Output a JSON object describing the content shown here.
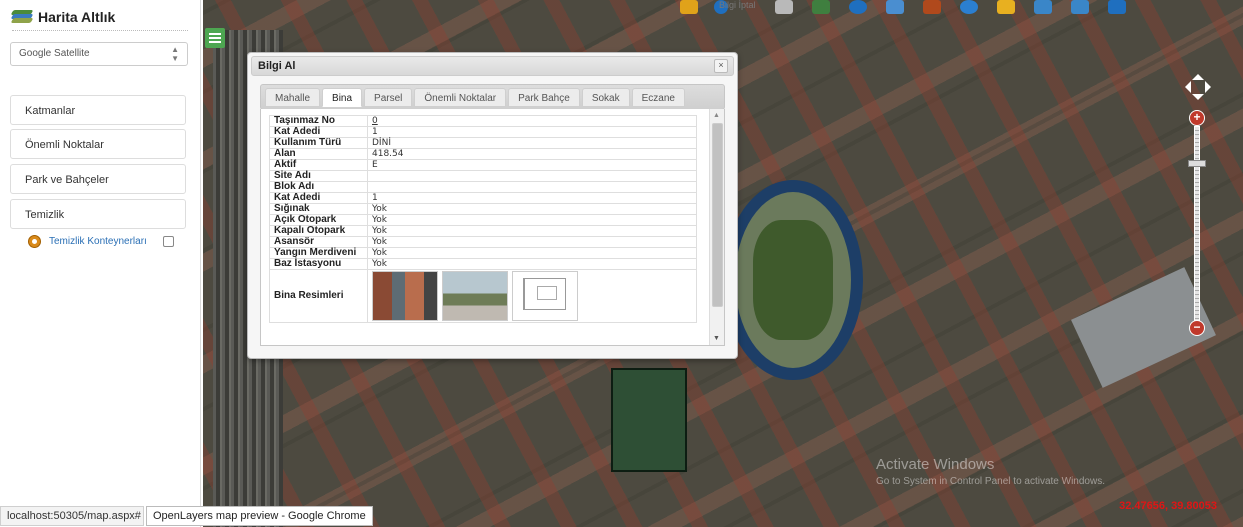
{
  "app": {
    "title": "Harita Altlık"
  },
  "sidebar": {
    "base_layer": {
      "selected": "Google Satellite"
    },
    "menu": [
      {
        "label": "Katmanlar"
      },
      {
        "label": "Önemli Noktalar"
      },
      {
        "label": "Park ve Bahçeler"
      },
      {
        "label": "Temizlik"
      }
    ],
    "temizlik_sub": {
      "label": "Temizlik Konteynerları",
      "checked": false
    }
  },
  "toolbar": {
    "items": [
      {
        "icon": "ruler-pencil-icon",
        "color": "#e0a21a"
      },
      {
        "icon": "info-icon",
        "label": "Bilgi İptal",
        "color": "#1f6fbf"
      },
      {
        "icon": "grid-icon",
        "color": "#b9b9b9"
      },
      {
        "icon": "layers-icon",
        "color": "#3f7f3f"
      },
      {
        "icon": "navigation-icon",
        "color": "#1f6fbf"
      },
      {
        "icon": "print-icon",
        "color": "#4a8ed0"
      },
      {
        "icon": "briefcase-icon",
        "color": "#b0491c"
      },
      {
        "icon": "globe-icon",
        "color": "#2b7fd0"
      },
      {
        "icon": "pan-hand-icon",
        "color": "#e8b020"
      },
      {
        "icon": "zoom-in-icon",
        "color": "#3a86c8"
      },
      {
        "icon": "zoom-out-icon",
        "color": "#3a86c8"
      },
      {
        "icon": "users-icon",
        "color": "#1f6fbf"
      }
    ]
  },
  "dialog": {
    "title": "Bilgi Al",
    "close": "×",
    "tabs": [
      {
        "label": "Mahalle",
        "active": false
      },
      {
        "label": "Bina",
        "active": true
      },
      {
        "label": "Parsel",
        "active": false
      },
      {
        "label": "Önemli Noktalar",
        "active": false
      },
      {
        "label": "Park Bahçe",
        "active": false
      },
      {
        "label": "Sokak",
        "active": false
      },
      {
        "label": "Eczane",
        "active": false
      }
    ],
    "rows": [
      {
        "key": "Taşınmaz No",
        "value": "0",
        "link": true
      },
      {
        "key": "Kat Adedi",
        "value": "1"
      },
      {
        "key": "Kullanım Türü",
        "value": "DİNİ"
      },
      {
        "key": "Alan",
        "value": "418.54"
      },
      {
        "key": "Aktif",
        "value": "E"
      },
      {
        "key": "Site Adı",
        "value": ""
      },
      {
        "key": "Blok Adı",
        "value": ""
      },
      {
        "key": "Kat Adedi",
        "value": "1"
      },
      {
        "key": "Sığınak",
        "value": "Yok"
      },
      {
        "key": "Açık Otopark",
        "value": "Yok"
      },
      {
        "key": "Kapalı Otopark",
        "value": "Yok"
      },
      {
        "key": "Asansör",
        "value": "Yok"
      },
      {
        "key": "Yangın Merdiveni",
        "value": "Yok"
      },
      {
        "key": "Baz İstasyonu",
        "value": "Yok"
      }
    ],
    "images_label": "Bina Resimleri"
  },
  "map": {
    "watermark_title": "Activate Windows",
    "watermark_sub": "Go to System in Control Panel to activate Windows.",
    "coords": "32.47656, 39.80053"
  },
  "statusbar": {
    "url": "localhost:50305/map.aspx#",
    "app": "OpenLayers map preview - Google Chrome"
  }
}
